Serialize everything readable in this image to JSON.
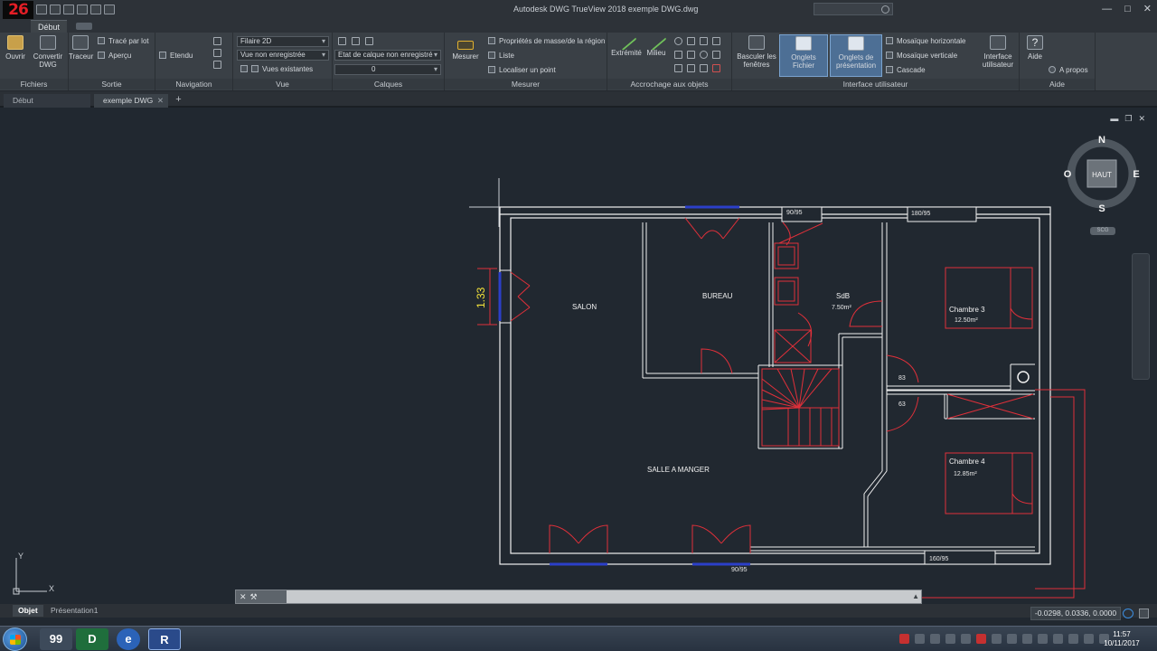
{
  "app": {
    "logo_text": "26",
    "title": "Autodesk DWG TrueView 2018     exemple DWG.dwg",
    "window_buttons": [
      "—",
      "□",
      "✕"
    ]
  },
  "ribbon": {
    "active_tab": "Début",
    "groups": {
      "fichiers": {
        "label": "Fichiers",
        "ouvrir": "Ouvrir",
        "convertir": "Convertir DWG"
      },
      "sortie": {
        "label": "Sortie",
        "traceur": "Traceur",
        "trace_par_lot": "Tracé par lot",
        "apercu": "Aperçu"
      },
      "navigation": {
        "label": "Navigation",
        "etendu": "Etendu"
      },
      "vue": {
        "label": "Vue",
        "style_visuel": "Filaire 2D",
        "vue_nommee": "Vue non enregistrée",
        "vues_existantes": "Vues existantes"
      },
      "calques": {
        "label": "Calques",
        "etat_calque": "Etat de calque non enregistré",
        "calque_courant": "0"
      },
      "mesurer": {
        "label": "Mesurer",
        "mesurer": "Mesurer",
        "proprietes": "Propriétés de masse/de la région",
        "liste": "Liste",
        "localiser": "Localiser un point"
      },
      "accrochage": {
        "label": "Accrochage aux objets",
        "extremite": "Extrémité",
        "milieu": "Milieu"
      },
      "interface": {
        "label": "Interface utilisateur",
        "basculer": "Basculer les fenêtres",
        "onglets_fichier": "Onglets Fichier",
        "onglets_presentation": "Onglets de présentation",
        "mosaique_h": "Mosaïque horizontale",
        "mosaique_v": "Mosaïque verticale",
        "cascade": "Cascade",
        "interface_utilisateur": "Interface utilisateur"
      },
      "aide": {
        "label": "Aide",
        "aide": "Aide",
        "a_propos": "A propos"
      }
    }
  },
  "doc_tabs": {
    "start": "Début",
    "file": "exemple DWG",
    "close_icon": "✕",
    "add_icon": "+"
  },
  "plan": {
    "rooms": {
      "salon": "SALON",
      "bureau": "BUREAU",
      "sdb": "SdB",
      "sdb_area": "7.50m²",
      "chambre3": "Chambre 3",
      "chambre3_area": "12.50m²",
      "chambre4": "Chambre 4",
      "chambre4_area": "12.85m²",
      "salle_a_manger": "SALLE A MANGER"
    },
    "window_tags": {
      "w1": "90/95",
      "w2": "180/95",
      "w3": "160/95",
      "w4": "90/95"
    },
    "dimension": "1.33",
    "door_tags": [
      "83",
      "63"
    ]
  },
  "viewcube": {
    "north": "N",
    "south": "S",
    "east": "E",
    "west": "O",
    "top": "HAUT",
    "wcs": "SCG"
  },
  "ucs": {
    "x": "X",
    "y": "Y"
  },
  "command_line": {
    "prompt": ""
  },
  "layout_tabs": [
    "Objet",
    "Présentation1"
  ],
  "status": {
    "coordinates": "-0.0298, 0.0336, 0.0000"
  },
  "taskbar": {
    "apps": [
      "",
      "99",
      "D",
      "e",
      "R"
    ],
    "time": "11:57",
    "date": "10/11/2017"
  },
  "colors": {
    "background": "#212830",
    "walls": "#f0f0f0",
    "layer_red": "#e0303a",
    "dimension": "#f3e23a",
    "window_blue": "#2c3fc9",
    "ribbon": "#3a4046"
  }
}
